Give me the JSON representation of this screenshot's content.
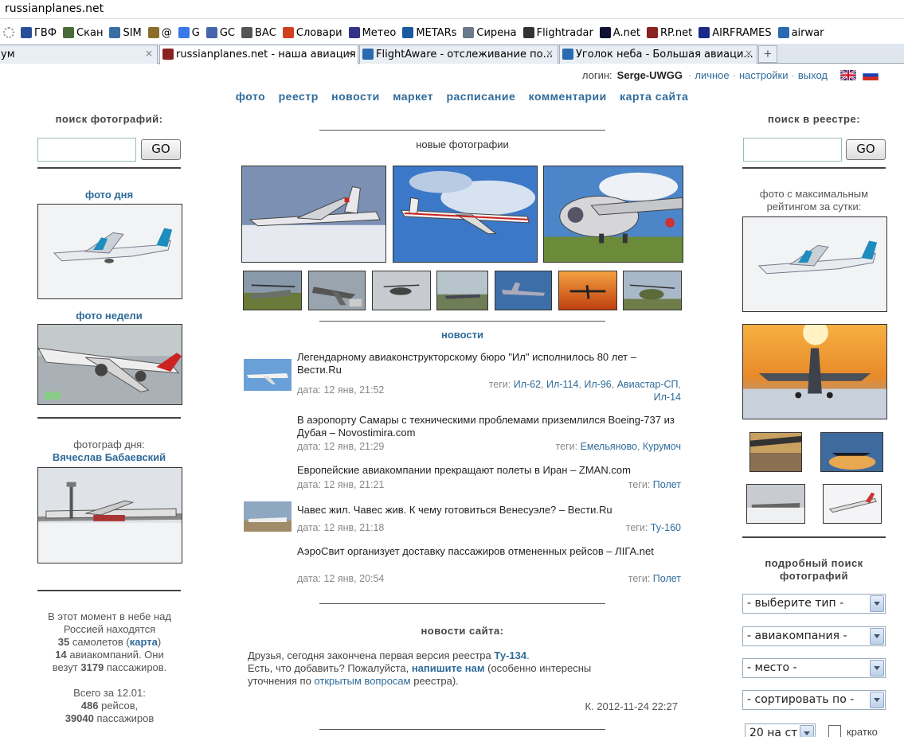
{
  "browser": {
    "url": "russianplanes.net",
    "bookmarks": [
      {
        "label": "",
        "icon": "loading-icon",
        "color": "#999999"
      },
      {
        "label": "ГВФ",
        "icon": "globe-icon",
        "color": "#2a4f9a"
      },
      {
        "label": "Скан",
        "icon": "radar-icon",
        "color": "#4a6b3a"
      },
      {
        "label": "SIM",
        "icon": "flag-icon",
        "color": "#3a6ea5"
      },
      {
        "label": "@",
        "icon": "mail-icon",
        "color": "#8a6d2a"
      },
      {
        "label": "G",
        "icon": "google-icon",
        "color": "#3b78e7"
      },
      {
        "label": "GC",
        "icon": "globe-icon",
        "color": "#4466aa"
      },
      {
        "label": "ВАС",
        "icon": "plane-icon",
        "color": "#555555"
      },
      {
        "label": "Словари",
        "icon": "dictionary-icon",
        "color": "#d04020"
      },
      {
        "label": "Метео",
        "icon": "weather-icon",
        "color": "#333388"
      },
      {
        "label": "METARs",
        "icon": "noaa-icon",
        "color": "#1a5aa0"
      },
      {
        "label": "Сирена",
        "icon": "plane-icon",
        "color": "#6a7a8a"
      },
      {
        "label": "Flightradar",
        "icon": "globe-icon",
        "color": "#333333"
      },
      {
        "label": "A.net",
        "icon": "anet-icon",
        "color": "#111133"
      },
      {
        "label": "RP.net",
        "icon": "rpnet-icon",
        "color": "#8a2020"
      },
      {
        "label": "AIRFRAMES",
        "icon": "airframes-icon",
        "color": "#1a2a8a"
      },
      {
        "label": "airwar",
        "icon": "airwar-icon",
        "color": "#2a6ab0"
      }
    ],
    "tabs": [
      {
        "label": "ум",
        "icon": "",
        "active": false
      },
      {
        "label": "russianplanes.net - наша авиация",
        "icon": "rpnet-icon",
        "active": true
      },
      {
        "label": "FlightAware - отслеживание по...",
        "icon": "plane-icon",
        "active": false
      },
      {
        "label": "Уголок неба - Большая авиаци...",
        "icon": "airwar-icon",
        "active": false
      }
    ],
    "tab_close": "×",
    "new_tab": "+"
  },
  "topbar": {
    "login_label": "логин:",
    "username": "Serge-UWGG",
    "personal": "личное",
    "settings": "настройки",
    "logout": "выход",
    "sep": "·"
  },
  "nav": [
    "фото",
    "реестр",
    "новости",
    "маркет",
    "расписание",
    "комментарии",
    "карта сайта"
  ],
  "left": {
    "search_heading": "поиск фотографий:",
    "search_value": "",
    "go": "GO",
    "photo_day": "фото дня",
    "photo_week": "фото недели",
    "photographer_label": "фотограф дня:",
    "photographer_name": "Вячеслав Бабаевский",
    "stats": {
      "line1": "В этот момент в небе над",
      "line2": "Россией находятся",
      "planes_count": "35",
      "planes_text": "самолетов",
      "map_link": "карта",
      "airlines_count": "14",
      "airlines_text": "авиакомпаний. Они",
      "carry_text": "везут",
      "passengers_count": "3179",
      "passengers_text": "пассажиров.",
      "total_label": "Всего за 12.01:",
      "flights_count": "486",
      "flights_text": "рейсов,",
      "total_pass_count": "39040",
      "total_pass_text": "пассажиров"
    }
  },
  "center": {
    "new_photos": "новые фотографии",
    "news_heading": "новости",
    "news": [
      {
        "title": "Легендарному авиаконструкторскому бюро \"Ил\" исполнилось 80 лет – Вести.Ru",
        "date": "дата: 12 янв, 21:52",
        "tags_label": "теги:",
        "tags": [
          "Ил-62",
          "Ил-114",
          "Ил-96",
          "Авиастар-СП",
          "Ил-14"
        ],
        "has_thumb": true
      },
      {
        "title": "В аэропорту Самары с техническими проблемами приземлился Boeing-737 из Дубая – Novostimira.com",
        "date": "дата: 12 янв, 21:29",
        "tags_label": "теги:",
        "tags": [
          "Емельяново",
          "Курумоч"
        ],
        "has_thumb": false
      },
      {
        "title": "Европейские авиакомпании прекращают полеты в Иран – ZMAN.com",
        "date": "дата: 12 янв, 21:21",
        "tags_label": "теги:",
        "tags": [
          "Полет"
        ],
        "has_thumb": false
      },
      {
        "title": "Чавес жил. Чавес жив. К чему готовиться Венесуэле? – Вести.Ru",
        "date": "дата: 12 янв, 21:18",
        "tags_label": "теги:",
        "tags": [
          "Ту-160"
        ],
        "has_thumb": true
      },
      {
        "title": "АэроСвит организует доставку пассажиров отмененных рейсов – ЛІГА.net",
        "date": "дата: 12 янв, 20:54",
        "tags_label": "теги:",
        "tags": [
          "Полет"
        ],
        "has_thumb": false
      }
    ],
    "site_news_heading": "новости сайта:",
    "site_news": {
      "p1a": "Друзья, сегодня закончена первая версия реестра",
      "p1link": "Ту-134",
      "p1b": ".",
      "p2a": "Есть, что добавить? Пожалуйста,",
      "p2link": "напишите нам",
      "p2b": "(особенно интересны",
      "p3a": "уточнения по",
      "p3link": "открытым вопросам",
      "p3b": "реестра).",
      "sig": "К. 2012-11-24 22:27"
    }
  },
  "right": {
    "search_heading": "поиск в реестре:",
    "search_value": "",
    "go": "GO",
    "top_rated_l1": "фото с максимальным",
    "top_rated_l2": "рейтингом за сутки:",
    "adv_search_l1": "подробный поиск",
    "adv_search_l2": "фотографий",
    "selects": [
      "- выберите тип -",
      "- авиакомпания -",
      "- место -",
      "- сортировать по -"
    ],
    "perpage": "20 на ст",
    "brief": "кратко"
  },
  "colors": {
    "link": "#2f6b9a",
    "text": "#333333",
    "date": "#888888"
  }
}
